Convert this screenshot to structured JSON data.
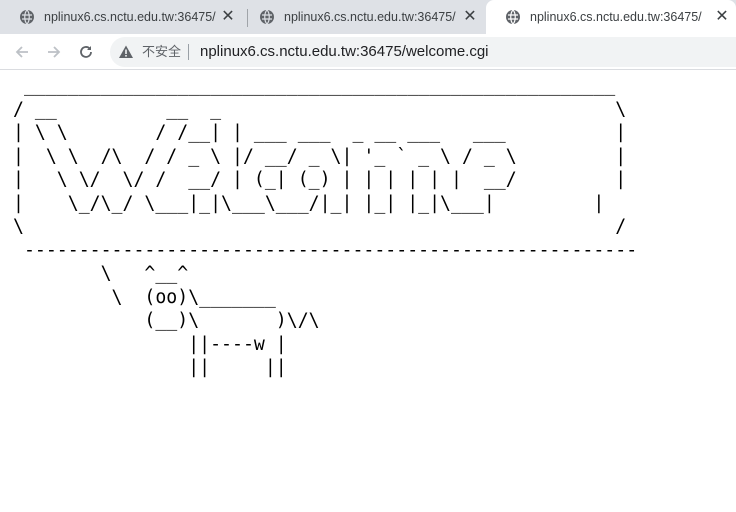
{
  "browser": {
    "tabs": [
      {
        "title": "nplinux6.cs.nctu.edu.tw:36475/"
      },
      {
        "title": "nplinux6.cs.nctu.edu.tw:36475/"
      },
      {
        "title": "nplinux6.cs.nctu.edu.tw:36475/"
      }
    ],
    "address_bar": {
      "security_label": "不安全",
      "url": "nplinux6.cs.nctu.edu.tw:36475/welcome.cgi"
    }
  },
  "page": {
    "ascii_art": " ______________________________________________________\n/ __          __  _                                    \\\n| \\ \\        / /__| | ___ ___  _ __ ___   ___          |\n|  \\ \\  /\\  / / _ \\ |/ __/ _ \\| '_ ` _ \\ / _ \\         |\n|   \\ \\/  \\/ /  __/ | (_| (_) | | | | | |  __/         |\n|    \\_/\\_/ \\___|_|\\___\\___/|_| |_| |_|\\___|         |\n\\                                                      /\n --------------------------------------------------------\n        \\   ^__^\n         \\  (oo)\\_______\n            (__)\\       )\\/\\\n                ||----w |\n                ||     ||"
  }
}
